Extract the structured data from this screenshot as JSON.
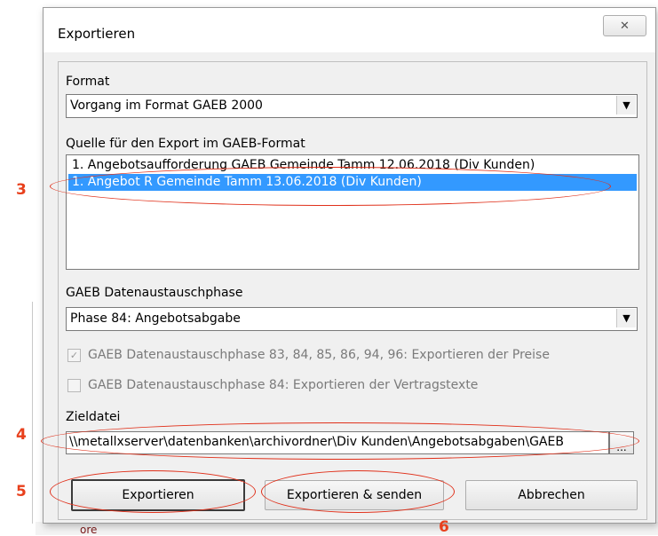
{
  "dialog": {
    "title": "Exportieren",
    "close_icon": "close-icon"
  },
  "format": {
    "label": "Format",
    "value": "Vorgang im Format GAEB 2000"
  },
  "source": {
    "label": "Quelle für den Export im GAEB-Format",
    "items": [
      "1. Angebotsaufforderung GAEB Gemeinde Tamm 12.06.2018 (Div Kunden)",
      "1. Angebot R Gemeinde Tamm 13.06.2018 (Div Kunden)"
    ],
    "selected_index": 1
  },
  "phase": {
    "label": "GAEB Datenaustauschphase",
    "value": "Phase 84: Angebotsabgabe"
  },
  "options": {
    "prices": {
      "label": "GAEB Datenaustauschphase 83, 84, 85, 86, 94, 96: Exportieren der Preise",
      "checked": true
    },
    "contract_texts": {
      "label": "GAEB Datenaustauschphase 84: Exportieren der Vertragstexte",
      "checked": false
    }
  },
  "target": {
    "label": "Zieldatei",
    "value": "\\\\metallxserver\\datenbanken\\archivordner\\Div Kunden\\Angebotsabgaben\\GAEB",
    "browse_label": "..."
  },
  "buttons": {
    "export": "Exportieren",
    "export_send": "Exportieren & senden",
    "cancel": "Abbrechen"
  },
  "annotations": {
    "n3": "3",
    "n4": "4",
    "n5": "5",
    "n6": "6",
    "color": "#e8401c"
  },
  "background": {
    "bottom_text": "ore"
  }
}
